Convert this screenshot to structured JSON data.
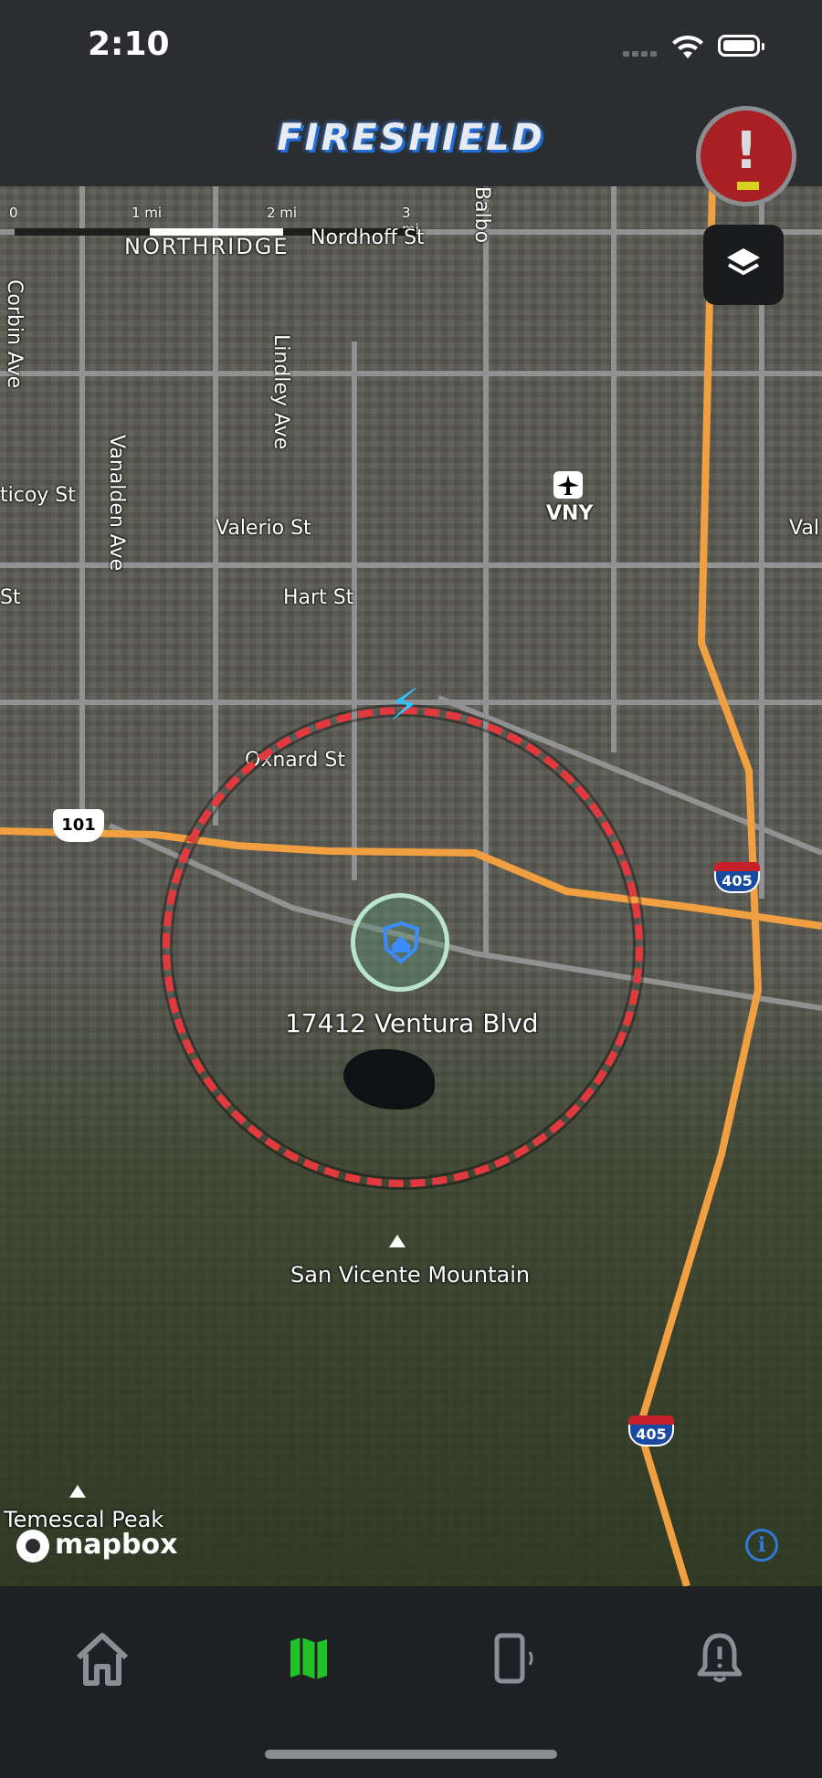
{
  "status_bar": {
    "time": "2:10"
  },
  "header": {
    "title": "FIRESHIELD"
  },
  "alert_button": {
    "icon": "alert-exclamation-icon",
    "color": "#a82024"
  },
  "map": {
    "scale": {
      "labels": [
        "0",
        "1 mi",
        "2 mi",
        "3 mi"
      ]
    },
    "labels": {
      "northridge": "NORTHRIDGE",
      "nordhoff": "Nordhoff St",
      "balboa": "Balbo",
      "corbin": "Corbin Ave",
      "lindley": "Lindley Ave",
      "vanalden": "Vanalden Ave",
      "saticoy": "ticoy St",
      "valerio": "Valerio St",
      "valerio_right": "Val",
      "hart": "Hart St",
      "st_left": "St",
      "oxnard": "Oxnard St",
      "vny": "VNY",
      "hwy101": "101",
      "i405_top": "405",
      "i405_bottom": "405",
      "san_vicente": "San Vicente Mountain",
      "temescal": "Temescal Peak",
      "mapbox": "mapbox"
    },
    "home": {
      "address": "17412 Ventura Blvd",
      "alert_radius_color": "#e03a3e"
    }
  },
  "tabs": [
    {
      "name": "home",
      "icon": "house-icon",
      "active": false
    },
    {
      "name": "map",
      "icon": "map-icon",
      "active": true
    },
    {
      "name": "device",
      "icon": "phone-vibrate-icon",
      "active": false
    },
    {
      "name": "alerts",
      "icon": "bell-alert-icon",
      "active": false
    }
  ],
  "colors": {
    "active_tab": "#22c12a",
    "inactive_tab": "#8a8f96",
    "title_glow": "#1f6fd6"
  }
}
